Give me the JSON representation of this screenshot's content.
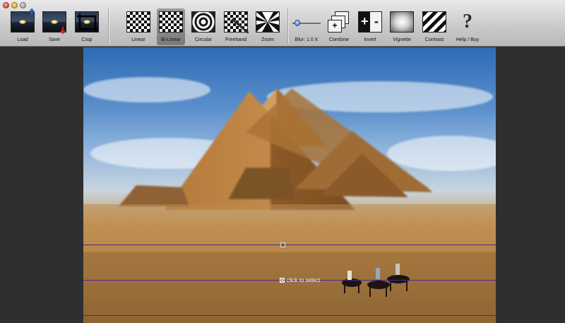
{
  "window": {
    "controls": [
      "close",
      "minimize",
      "zoom"
    ]
  },
  "toolbar": {
    "items": [
      {
        "id": "load",
        "label": "Load",
        "icon": "photo-open-icon"
      },
      {
        "id": "save",
        "label": "Save",
        "icon": "photo-save-icon"
      },
      {
        "id": "crop",
        "label": "Crop",
        "icon": "crop-icon"
      },
      {
        "id": "linear",
        "label": "Linear",
        "icon": "linear-blur-icon"
      },
      {
        "id": "bilinear",
        "label": "Bi-Linear",
        "icon": "bilinear-blur-icon",
        "selected": true
      },
      {
        "id": "circular",
        "label": "Circular",
        "icon": "circular-blur-icon"
      },
      {
        "id": "freehand",
        "label": "Freehand",
        "icon": "freehand-blur-icon"
      },
      {
        "id": "zoom",
        "label": "Zoom",
        "icon": "zoom-blur-icon"
      },
      {
        "id": "blur",
        "label": "Blur: 1.0 X",
        "icon": "blur-slider-icon"
      },
      {
        "id": "combine",
        "label": "Combine",
        "icon": "combine-icon"
      },
      {
        "id": "invert",
        "label": "Invert",
        "icon": "invert-icon"
      },
      {
        "id": "vignette",
        "label": "Vignette",
        "icon": "vignette-icon"
      },
      {
        "id": "contrast",
        "label": "Contrast",
        "icon": "contrast-icon"
      },
      {
        "id": "help",
        "label": "Help / Buy",
        "icon": "help-icon"
      }
    ],
    "blur_level": 0.1
  },
  "canvas": {
    "hint": "click to select",
    "colors": {
      "guide_line": "#4a2a8c",
      "background": "#2f2f2f"
    }
  }
}
